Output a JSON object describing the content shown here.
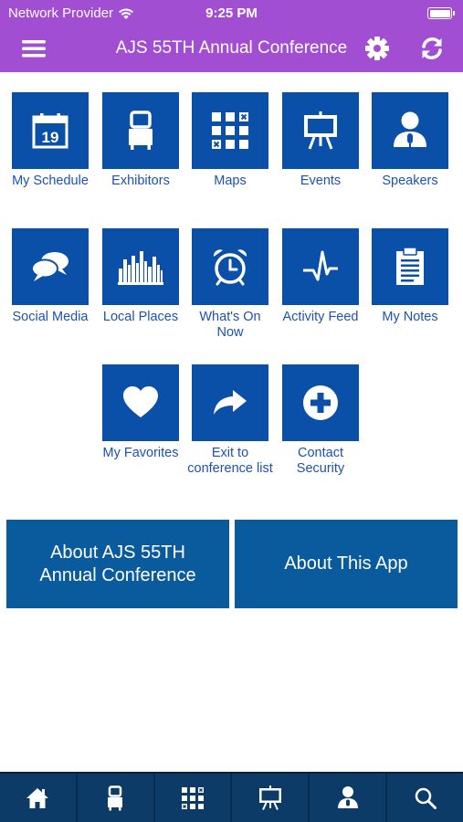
{
  "status_bar": {
    "carrier": "Network Provider",
    "time": "9:25 PM"
  },
  "header": {
    "title": "AJS 55TH Annual Conference",
    "background_color": "#a24ed2",
    "icons": [
      "menu-icon",
      "gear-icon",
      "refresh-icon"
    ]
  },
  "grid": {
    "tile_color": "#0a4fa8",
    "label_color": "#1c52b0",
    "items": [
      {
        "label": "My Schedule",
        "icon": "calendar-icon",
        "calendar_day": "19"
      },
      {
        "label": "Exhibitors",
        "icon": "booth-icon"
      },
      {
        "label": "Maps",
        "icon": "grid-map-icon"
      },
      {
        "label": "Events",
        "icon": "easel-icon"
      },
      {
        "label": "Speakers",
        "icon": "speaker-icon"
      },
      {
        "label": "Social Media",
        "icon": "chat-bubbles-icon"
      },
      {
        "label": "Local Places",
        "icon": "city-skyline-icon"
      },
      {
        "label": "What's On Now",
        "icon": "alarm-clock-icon"
      },
      {
        "label": "Activity Feed",
        "icon": "pulse-icon"
      },
      {
        "label": "My Notes",
        "icon": "clipboard-icon"
      },
      {
        "label": "My Favorites",
        "icon": "heart-icon"
      },
      {
        "label": "Exit to conference list",
        "icon": "share-arrow-icon"
      },
      {
        "label": "Contact Security",
        "icon": "plus-circle-icon"
      }
    ]
  },
  "buttons": {
    "about_conference": "About AJS 55TH Annual Conference",
    "about_app": "About This App",
    "color": "#0a5a9e"
  },
  "tab_bar": {
    "background_color": "#0c3b68",
    "items": [
      "home-icon",
      "booth-icon",
      "grid-map-icon",
      "easel-icon",
      "speaker-icon",
      "search-icon"
    ]
  }
}
